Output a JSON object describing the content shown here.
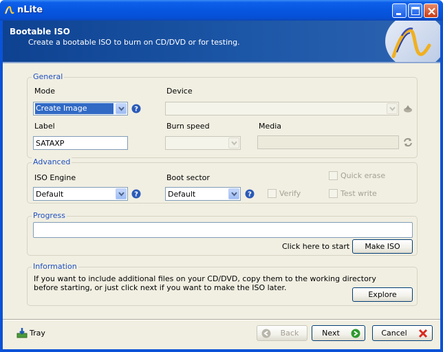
{
  "window": {
    "title": "nLite"
  },
  "header": {
    "title": "Bootable ISO",
    "subtitle": "Create a bootable ISO to burn on CD/DVD or for testing."
  },
  "general": {
    "group_label": "General",
    "mode_label": "Mode",
    "mode_value": "Create Image",
    "device_label": "Device",
    "device_value": "",
    "label_label": "Label",
    "label_value": "SATAXP",
    "burn_speed_label": "Burn speed",
    "burn_speed_value": "",
    "media_label": "Media",
    "media_value": ""
  },
  "advanced": {
    "group_label": "Advanced",
    "iso_engine_label": "ISO Engine",
    "iso_engine_value": "Default",
    "boot_sector_label": "Boot sector",
    "boot_sector_value": "Default",
    "verify_label": "Verify",
    "quick_erase_label": "Quick erase",
    "test_write_label": "Test write"
  },
  "progress": {
    "group_label": "Progress",
    "hint": "Click here to start ->",
    "make_iso_label": "Make ISO"
  },
  "information": {
    "group_label": "Information",
    "line1": "If you want to include additional files on your CD/DVD, copy them to the working directory",
    "line2": "before starting, or just click next if you want to make the ISO later.",
    "explore_label": "Explore"
  },
  "footer": {
    "tray_label": "Tray",
    "back_label": "Back",
    "next_label": "Next",
    "cancel_label": "Cancel"
  },
  "colors": {
    "titlebar": "#0756e0",
    "header_bg": "#1c56a6",
    "group_label": "#1f4fbf",
    "client_bg": "#f1efe2",
    "selection": "#316ac5"
  }
}
